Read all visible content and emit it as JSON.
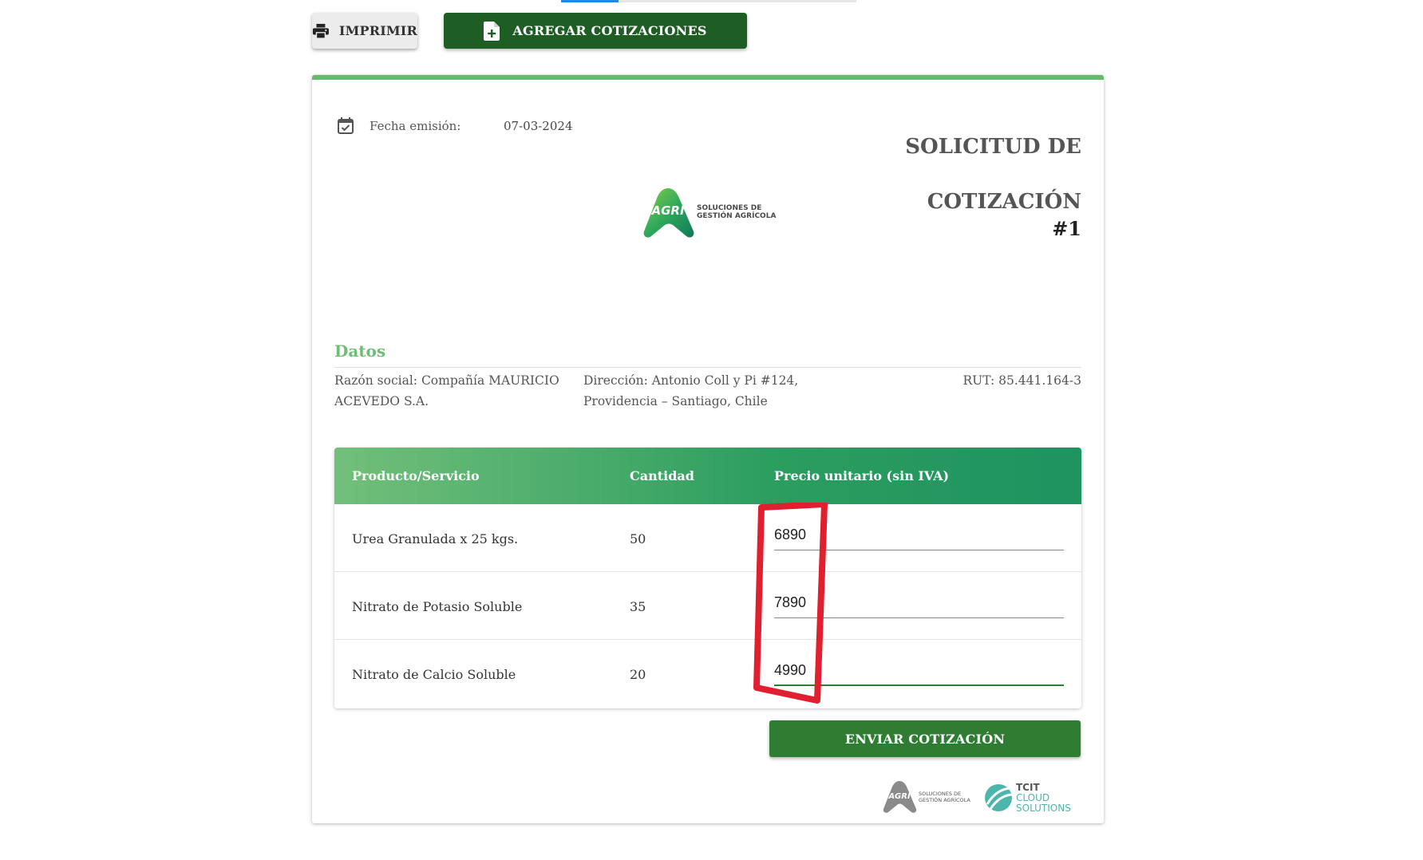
{
  "toolbar": {
    "print_label": "IMPRIMIR",
    "add_label": "AGREGAR COTIZACIONES"
  },
  "document": {
    "date_label": "Fecha emisión:",
    "date_value": "07-03-2024",
    "title_line1": "SOLICITUD DE",
    "title_line2": "COTIZACIÓN",
    "number": "#1",
    "logo_brand": "AGRI",
    "logo_subtitle_1": "SOLUCIONES DE",
    "logo_subtitle_2": "GESTIÓN AGRÍCOLA"
  },
  "datos": {
    "section_title": "Datos",
    "razon_social": "Razón social: Compañía MAURICIO ACEVEDO S.A.",
    "direccion": "Dirección: Antonio Coll y Pi #124, Providencia – Santiago, Chile",
    "rut": "RUT: 85.441.164-3"
  },
  "table": {
    "headers": [
      "Producto/Servicio",
      "Cantidad",
      "Precio unitario (sin IVA)"
    ],
    "rows": [
      {
        "product": "Urea Granulada x 25 kgs.",
        "quantity": "50",
        "price": "6890"
      },
      {
        "product": "Nitrato de Potasio Soluble",
        "quantity": "35",
        "price": "7890"
      },
      {
        "product": "Nitrato de Calcio Soluble",
        "quantity": "20",
        "price": "4990"
      }
    ]
  },
  "actions": {
    "send_label": "ENVIAR COTIZACIÓN"
  },
  "footer": {
    "agri_brand": "AGRI",
    "agri_sub_1": "SOLUCIONES DE",
    "agri_sub_2": "GESTIÓN AGRÍCOLA",
    "tcit_1": "TCIT",
    "tcit_2": "CLOUD",
    "tcit_3": "SOLUTIONS"
  },
  "colors": {
    "accent_green": "#66bb6a",
    "dark_green": "#1e5e25",
    "button_green": "#2e7d32",
    "annotation_red": "#e0202f",
    "tab_blue": "#1e88e5"
  }
}
